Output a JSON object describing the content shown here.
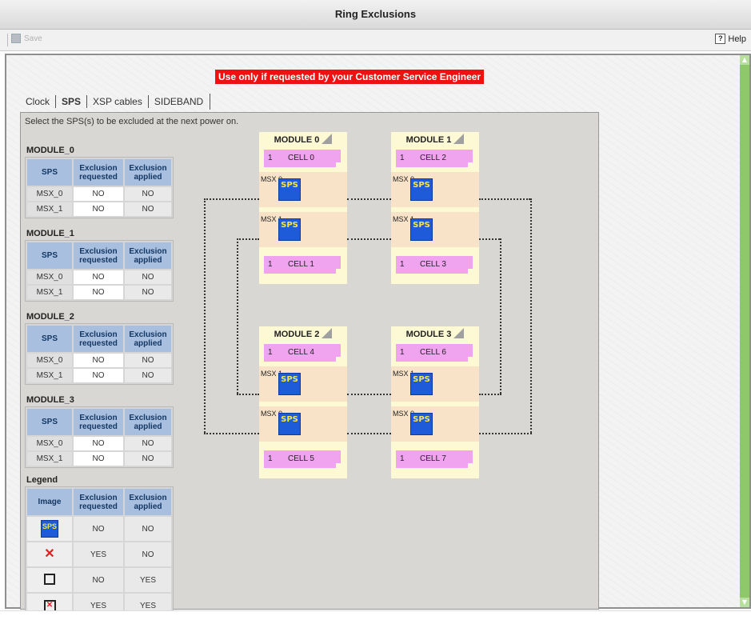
{
  "window": {
    "title": "Ring Exclusions"
  },
  "toolbar": {
    "save_label": "Save",
    "help_label": "Help"
  },
  "warning": "Use only if requested by your Customer Service Engineer",
  "tabs": [
    {
      "label": "Clock",
      "active": false
    },
    {
      "label": "SPS",
      "active": true
    },
    {
      "label": "XSP cables",
      "active": false
    },
    {
      "label": "SIDEBAND",
      "active": false
    }
  ],
  "instruction": "Select the SPS(s) to be excluded at the next power on.",
  "table_headers": {
    "sps": "SPS",
    "requested": "Exclusion requested",
    "applied": "Exclusion applied"
  },
  "modules": [
    {
      "name": "MODULE_0",
      "rows": [
        {
          "sps": "MSX_0",
          "requested": "NO",
          "applied": "NO"
        },
        {
          "sps": "MSX_1",
          "requested": "NO",
          "applied": "NO"
        }
      ]
    },
    {
      "name": "MODULE_1",
      "rows": [
        {
          "sps": "MSX_0",
          "requested": "NO",
          "applied": "NO"
        },
        {
          "sps": "MSX_1",
          "requested": "NO",
          "applied": "NO"
        }
      ]
    },
    {
      "name": "MODULE_2",
      "rows": [
        {
          "sps": "MSX_0",
          "requested": "NO",
          "applied": "NO"
        },
        {
          "sps": "MSX_1",
          "requested": "NO",
          "applied": "NO"
        }
      ]
    },
    {
      "name": "MODULE_3",
      "rows": [
        {
          "sps": "MSX_0",
          "requested": "NO",
          "applied": "NO"
        },
        {
          "sps": "MSX_1",
          "requested": "NO",
          "applied": "NO"
        }
      ]
    }
  ],
  "legend": {
    "title": "Legend",
    "image_header": "Image",
    "rows": [
      {
        "icon": "sps-icon",
        "requested": "NO",
        "applied": "NO"
      },
      {
        "icon": "red-x-icon",
        "requested": "YES",
        "applied": "NO"
      },
      {
        "icon": "empty-box-icon",
        "requested": "NO",
        "applied": "YES"
      },
      {
        "icon": "boxed-x-icon",
        "requested": "YES",
        "applied": "YES"
      }
    ]
  },
  "diagram": {
    "sps_label": "SPS",
    "modules": [
      {
        "title": "MODULE 0",
        "top_cell": {
          "num": "1",
          "name": "CELL 0"
        },
        "msx_upper": "MSX 0",
        "msx_lower": "MSX 1",
        "bottom_cell": {
          "num": "1",
          "name": "CELL 1"
        }
      },
      {
        "title": "MODULE 1",
        "top_cell": {
          "num": "1",
          "name": "CELL 2"
        },
        "msx_upper": "MSX 0",
        "msx_lower": "MSX 1",
        "bottom_cell": {
          "num": "1",
          "name": "CELL 3"
        }
      },
      {
        "title": "MODULE 2",
        "top_cell": {
          "num": "1",
          "name": "CELL 4"
        },
        "msx_upper": "MSX 1",
        "msx_lower": "MSX 0",
        "bottom_cell": {
          "num": "1",
          "name": "CELL 5"
        }
      },
      {
        "title": "MODULE 3",
        "top_cell": {
          "num": "1",
          "name": "CELL 6"
        },
        "msx_upper": "MSX 1",
        "msx_lower": "MSX 0",
        "bottom_cell": {
          "num": "1",
          "name": "CELL 7"
        }
      }
    ]
  }
}
